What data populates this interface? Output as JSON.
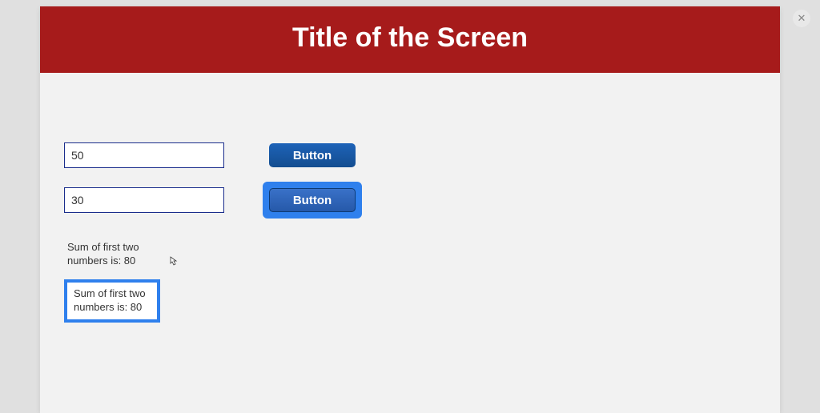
{
  "header": {
    "title": "Title of the Screen"
  },
  "inputs": {
    "first": "50",
    "second": "30"
  },
  "buttons": {
    "first": "Button",
    "second": "Button"
  },
  "results": {
    "plain": "Sum of first two numbers is: 80",
    "boxed": "Sum of first two numbers is: 80"
  },
  "close": "✕"
}
